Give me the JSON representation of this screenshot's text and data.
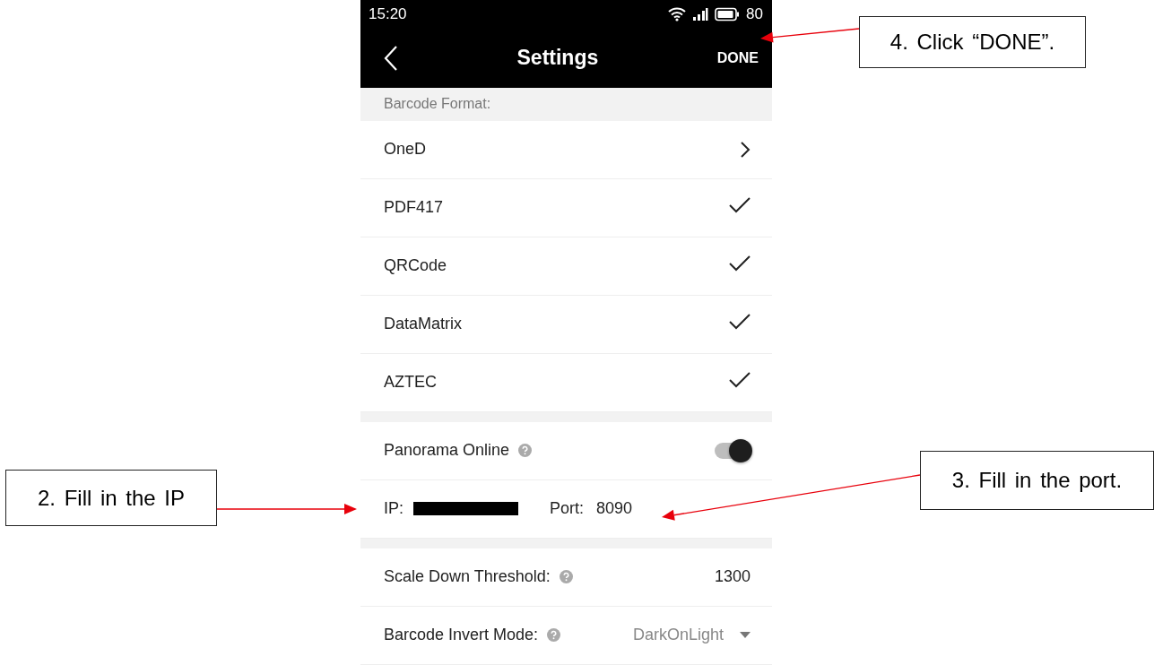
{
  "status_bar": {
    "time": "15:20",
    "battery": "80"
  },
  "header": {
    "title": "Settings",
    "action": "DONE"
  },
  "sections": [
    {
      "title": "Barcode Format:",
      "rows": [
        {
          "kind": "link",
          "label": "OneD"
        },
        {
          "kind": "check",
          "label": "PDF417",
          "checked": true
        },
        {
          "kind": "check",
          "label": "QRCode",
          "checked": true
        },
        {
          "kind": "check",
          "label": "DataMatrix",
          "checked": true
        },
        {
          "kind": "check",
          "label": "AZTEC",
          "checked": true
        }
      ]
    },
    {
      "rows": [
        {
          "kind": "toggle",
          "label": "Panorama Online",
          "help": true,
          "on": true
        },
        {
          "kind": "address",
          "ip_label": "IP:",
          "ip_redacted": true,
          "port_label": "Port:",
          "port_value": "8090"
        }
      ]
    },
    {
      "rows": [
        {
          "kind": "value",
          "label": "Scale Down Threshold:",
          "help": true,
          "value": "1300"
        },
        {
          "kind": "select",
          "label": "Barcode Invert Mode:",
          "help": true,
          "value": "DarkOnLight"
        }
      ]
    }
  ],
  "callouts": [
    {
      "text": "4. Click “DONE”."
    },
    {
      "text": "3. Fill in the port."
    },
    {
      "text": "2. Fill in the IP"
    }
  ]
}
